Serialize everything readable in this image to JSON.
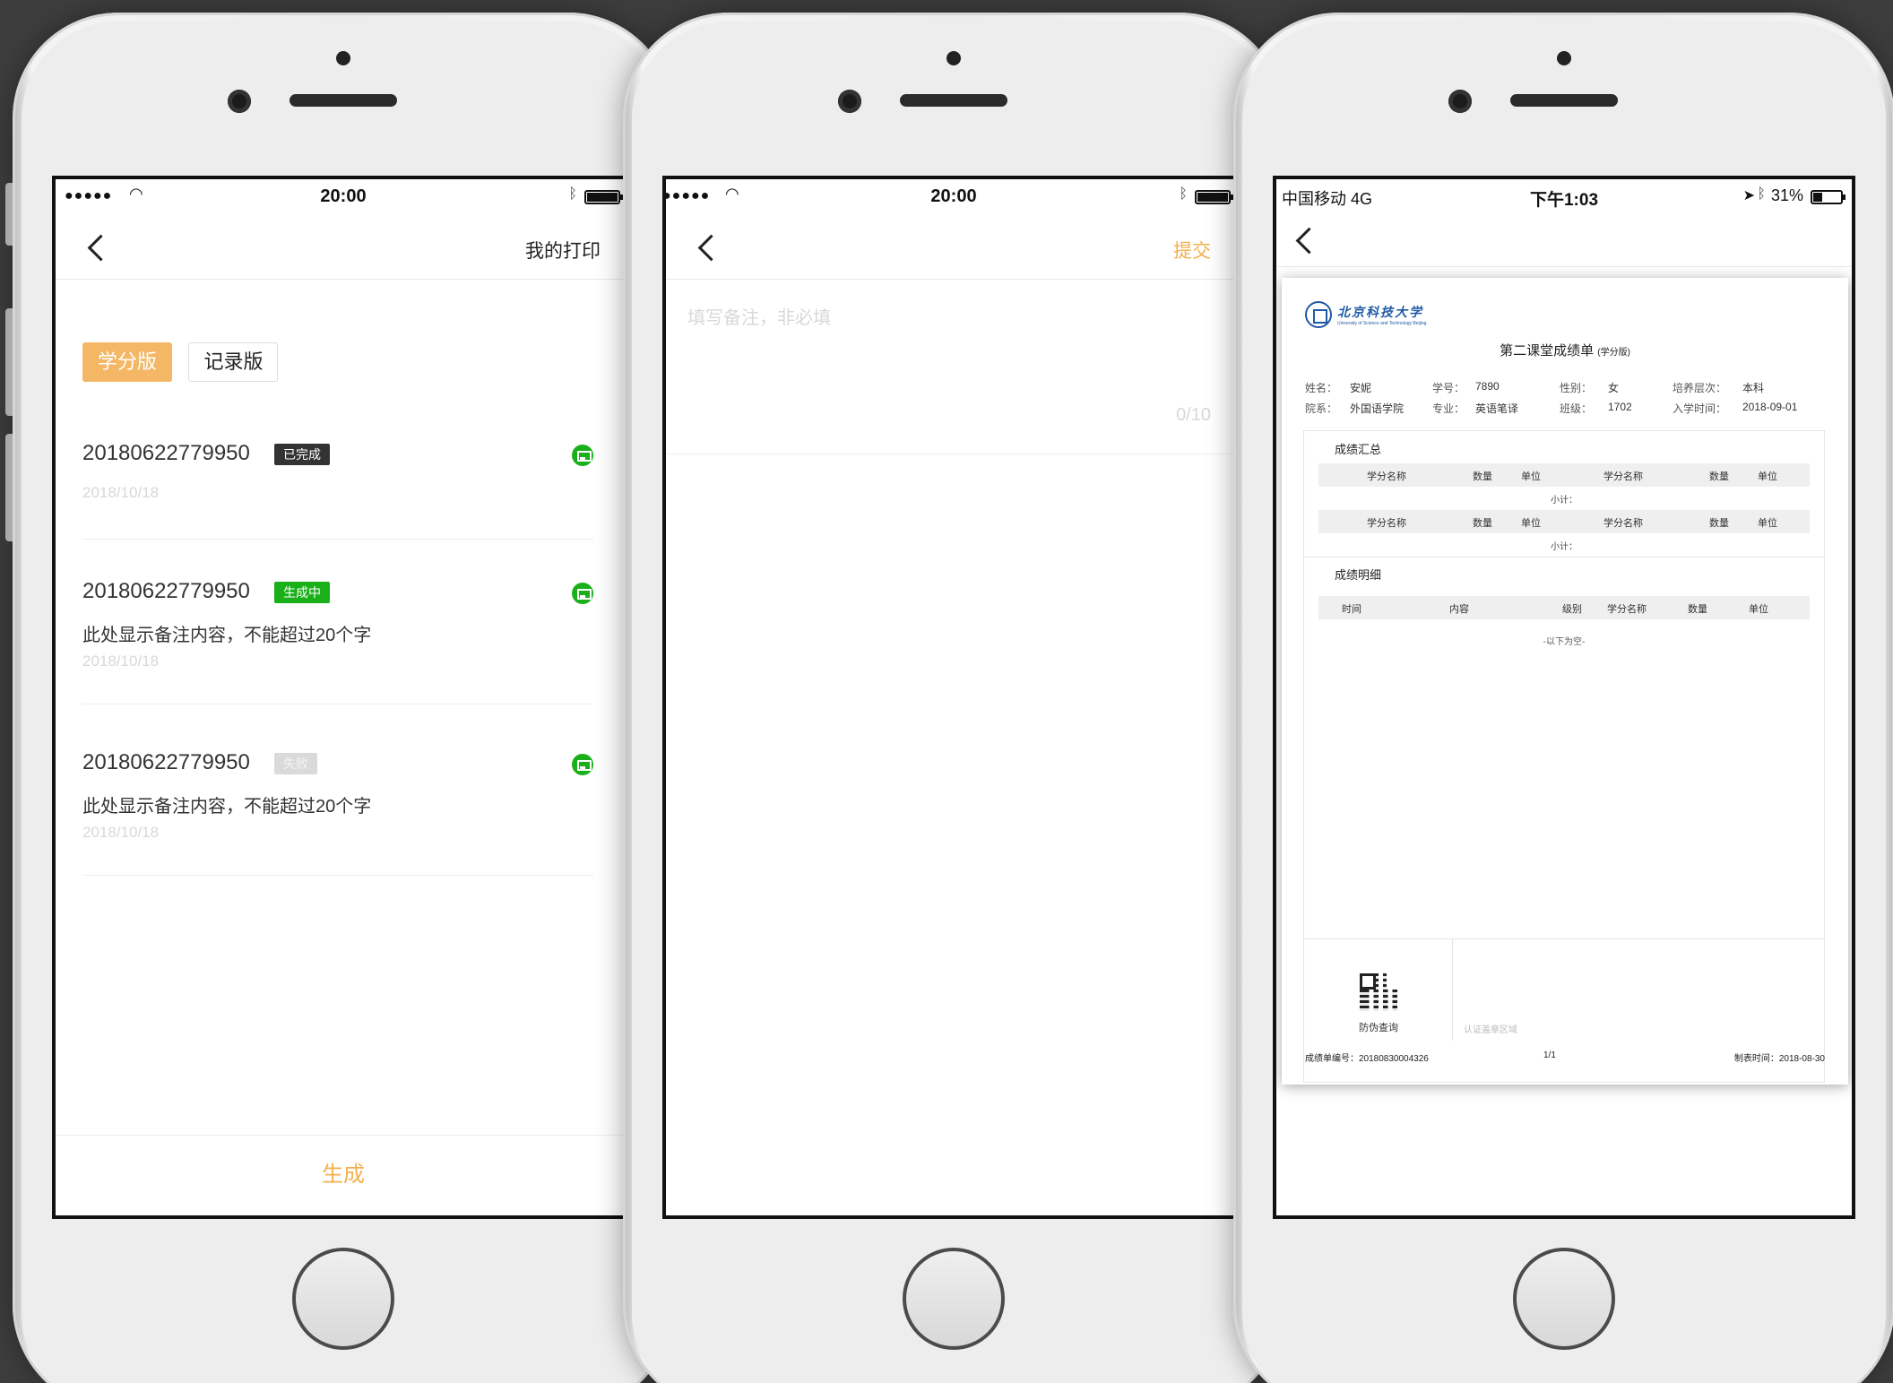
{
  "screen1": {
    "status": {
      "signal": "●●●●●",
      "time": "20:00"
    },
    "nav": {
      "title": "我的打印"
    },
    "tabs": [
      {
        "label": "学分版",
        "active": true
      },
      {
        "label": "记录版",
        "active": false
      }
    ],
    "records": [
      {
        "number": "20180622779950",
        "badge": "已完成",
        "note": "",
        "date": "2018/10/18"
      },
      {
        "number": "20180622779950",
        "badge": "生成中",
        "note": "此处显示备注内容，不能超过20个字",
        "date": "2018/10/18"
      },
      {
        "number": "20180622779950",
        "badge": "失败",
        "note": "此处显示备注内容，不能超过20个字",
        "date": "2018/10/18"
      }
    ],
    "generate_label": "生成"
  },
  "screen2": {
    "status": {
      "signal": "●●●●●",
      "time": "20:00"
    },
    "nav": {
      "submit_label": "提交"
    },
    "remark": {
      "placeholder": "填写备注，非必填",
      "counter": "0/10"
    }
  },
  "screen3": {
    "status": {
      "carrier": "中国移动   4G",
      "time": "下午1:03",
      "battery": "31%"
    },
    "doc": {
      "school_cn": "北京科技大学",
      "school_en": "University of Science and Technology Beijing",
      "title": "第二课堂成绩单",
      "title_suffix": "(学分版)",
      "info": {
        "name_k": "姓名：",
        "name_v": "安妮",
        "sid_k": "学号：",
        "sid_v": "7890",
        "gender_k": "性别：",
        "gender_v": "女",
        "level_k": "培养层次：",
        "level_v": "本科",
        "dept_k": "院系：",
        "dept_v": "外国语学院",
        "major_k": "专业：",
        "major_v": "英语笔译",
        "class_k": "班级：",
        "class_v": "1702",
        "enroll_k": "入学时间：",
        "enroll_v": "2018-09-01"
      },
      "summary_title": "成绩汇总",
      "summary_headers": [
        "学分名称",
        "数量",
        "单位",
        "学分名称",
        "数量",
        "单位"
      ],
      "subtotal": "小计：",
      "detail_title": "成绩明细",
      "detail_headers": [
        "时间",
        "内容",
        "级别",
        "学分名称",
        "数量",
        "单位"
      ],
      "empty": "-以下为空-",
      "qr_label": "防伪查询",
      "seal_area": "认证盖章区域",
      "footer": {
        "serial": "成绩单编号：20180830004326",
        "page": "1/1",
        "made": "制表时间：2018-08-30"
      }
    }
  },
  "colors": {
    "accent": "#f3b04e",
    "green": "#1ab01a",
    "dark_badge": "#333333"
  }
}
